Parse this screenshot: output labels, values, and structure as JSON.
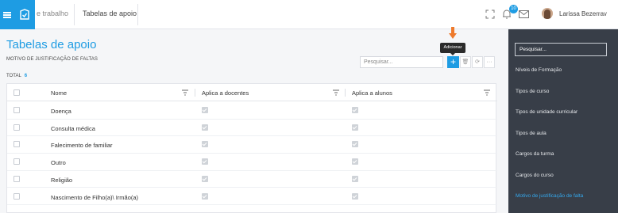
{
  "header": {
    "breadcrumb_prev": "e trabalho",
    "breadcrumb_current": "Tabelas de apoio",
    "notification_count": "10",
    "user_name": "Larissa Bezerra",
    "icons": [
      "menu-icon",
      "app-logo-icon",
      "fullscreen-icon",
      "bell-icon",
      "mail-icon",
      "chevron-down-icon"
    ]
  },
  "main": {
    "title": "Tabelas de apoio",
    "subtitle": "MOTIVO DE JUSTIFICAÇÃO DE FALTAS",
    "total_label": "TOTAL",
    "total_value": "6",
    "search_placeholder": "Pesquisar...",
    "add_tooltip": "Adicionar",
    "add_symbol": "+",
    "tool_icons": [
      "delete-icon",
      "refresh-icon",
      "more-icon"
    ],
    "tool_glyphs": [
      "🗑",
      "⟳",
      "···"
    ],
    "accent_color": "#1e9ce3"
  },
  "table": {
    "columns": [
      "Nome",
      "Aplica a docentes",
      "Aplica a alunos"
    ],
    "rows": [
      {
        "nome": "Doença",
        "docentes": true,
        "alunos": true
      },
      {
        "nome": "Consulta médica",
        "docentes": true,
        "alunos": true
      },
      {
        "nome": "Falecimento de familiar",
        "docentes": true,
        "alunos": true
      },
      {
        "nome": "Outro",
        "docentes": true,
        "alunos": true
      },
      {
        "nome": "Religião",
        "docentes": true,
        "alunos": true
      },
      {
        "nome": "Nascimento de Filho(a)\\ Irmão(a)",
        "docentes": true,
        "alunos": true
      }
    ]
  },
  "sidebar": {
    "search_placeholder": "Pesquisar...",
    "items": [
      {
        "label": "Níveis de Formação",
        "active": false
      },
      {
        "label": "Tipos de curso",
        "active": false
      },
      {
        "label": "Tipos de unidade curricular",
        "active": false
      },
      {
        "label": "Tipos de aula",
        "active": false
      },
      {
        "label": "Cargos da turma",
        "active": false
      },
      {
        "label": "Cargos do curso",
        "active": false
      },
      {
        "label": "Motivo de justificação de falta",
        "active": true
      }
    ]
  }
}
